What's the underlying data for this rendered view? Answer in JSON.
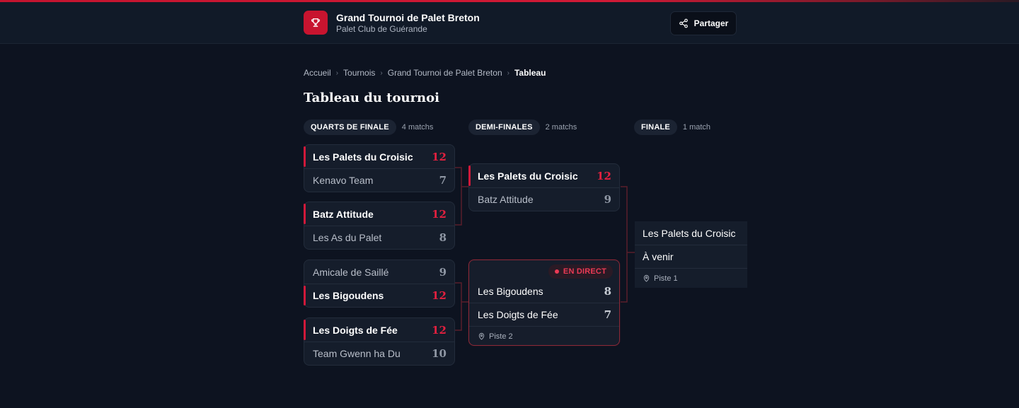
{
  "header": {
    "title": "Grand Tournoi de Palet Breton",
    "subtitle": "Palet Club de Guérande",
    "logo_icon": "trophy-icon",
    "share_label": "Partager",
    "share_icon": "share-icon"
  },
  "breadcrumb": [
    {
      "label": "Accueil"
    },
    {
      "label": "Tournois"
    },
    {
      "label": "Grand Tournoi de Palet Breton"
    },
    {
      "label": "Tableau"
    }
  ],
  "page_title": "Tableau du tournoi",
  "rounds": [
    {
      "name": "QUARTS DE FINALE",
      "count": "4 matchs",
      "matches": [
        {
          "teams": [
            {
              "name": "Les Palets du Croisic",
              "score": "12",
              "winner": true
            },
            {
              "name": "Kenavo Team",
              "score": "7",
              "winner": false
            }
          ]
        },
        {
          "teams": [
            {
              "name": "Batz Attitude",
              "score": "12",
              "winner": true
            },
            {
              "name": "Les As du Palet",
              "score": "8",
              "winner": false
            }
          ]
        },
        {
          "teams": [
            {
              "name": "Amicale de Saillé",
              "score": "9",
              "winner": false
            },
            {
              "name": "Les Bigoudens",
              "score": "12",
              "winner": true
            }
          ]
        },
        {
          "teams": [
            {
              "name": "Les Doigts de Fée",
              "score": "12",
              "winner": true
            },
            {
              "name": "Team Gwenn ha Du",
              "score": "10",
              "winner": false
            }
          ]
        }
      ]
    },
    {
      "name": "DEMI-FINALES",
      "count": "2 matchs",
      "matches": [
        {
          "teams": [
            {
              "name": "Les Palets du Croisic",
              "score": "12",
              "winner": true
            },
            {
              "name": "Batz Attitude",
              "score": "9",
              "winner": false
            }
          ]
        },
        {
          "live_label": "EN DIRECT",
          "teams": [
            {
              "name": "Les Bigoudens",
              "score": "8"
            },
            {
              "name": "Les Doigts de Fée",
              "score": "7"
            }
          ],
          "venue": "Piste 2"
        }
      ]
    },
    {
      "name": "FINALE",
      "count": "1 match",
      "matches": [
        {
          "teams": [
            {
              "name": "Les Palets du Croisic"
            },
            {
              "name": "À venir"
            }
          ],
          "venue": "Piste 1"
        }
      ]
    }
  ],
  "colors": {
    "accent": "#c8142f",
    "background": "#0d1320",
    "card": "#151d2b",
    "live": "#ec3a55"
  }
}
